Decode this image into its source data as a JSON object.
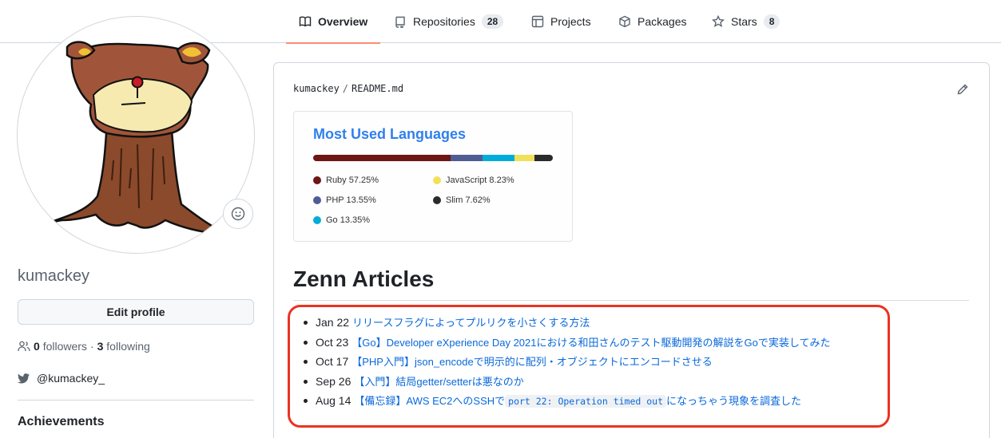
{
  "nav": {
    "tabs": [
      {
        "label": "Overview",
        "icon": "book-icon",
        "active": true
      },
      {
        "label": "Repositories",
        "icon": "repo-icon",
        "count": "28"
      },
      {
        "label": "Projects",
        "icon": "table-icon"
      },
      {
        "label": "Packages",
        "icon": "package-icon"
      },
      {
        "label": "Stars",
        "icon": "star-icon",
        "count": "8"
      }
    ]
  },
  "profile": {
    "username": "kumackey",
    "edit_label": "Edit profile",
    "followers_count": "0",
    "followers_label": "followers",
    "separator": "·",
    "following_count": "3",
    "following_label": "following",
    "twitter": "@kumackey_",
    "achievements_heading": "Achievements"
  },
  "readme": {
    "owner": "kumackey",
    "path_sep": "/",
    "file": "README.md",
    "languages": {
      "title": "Most Used Languages",
      "items": [
        {
          "label": "Ruby 57.25%",
          "percent": 57.25,
          "color": "#701516"
        },
        {
          "label": "PHP 13.55%",
          "percent": 13.55,
          "color": "#4F5D95"
        },
        {
          "label": "Go 13.35%",
          "percent": 13.35,
          "color": "#00ADD8"
        },
        {
          "label": "JavaScript 8.23%",
          "percent": 8.23,
          "color": "#f1e05a"
        },
        {
          "label": "Slim 7.62%",
          "percent": 7.62,
          "color": "#2b2b2b"
        }
      ]
    },
    "zenn_title": "Zenn Articles",
    "articles": [
      {
        "date": "Jan 22",
        "title": "リリースフラグによってプルリクを小さくする方法"
      },
      {
        "date": "Oct 23",
        "title": "【Go】Developer eXperience Day 2021における和田さんのテスト駆動開発の解説をGoで実装してみた"
      },
      {
        "date": "Oct 17",
        "title": "【PHP入門】json_encodeで明示的に配列・オブジェクトにエンコードさせる"
      },
      {
        "date": "Sep 26",
        "title": "【入門】結局getter/setterは悪なのか"
      },
      {
        "date": "Aug 14",
        "title_pre": "【備忘録】AWS EC2へのSSHで",
        "title_code": "port 22: Operation timed out",
        "title_post": "になっちゃう現象を調査した"
      }
    ]
  }
}
